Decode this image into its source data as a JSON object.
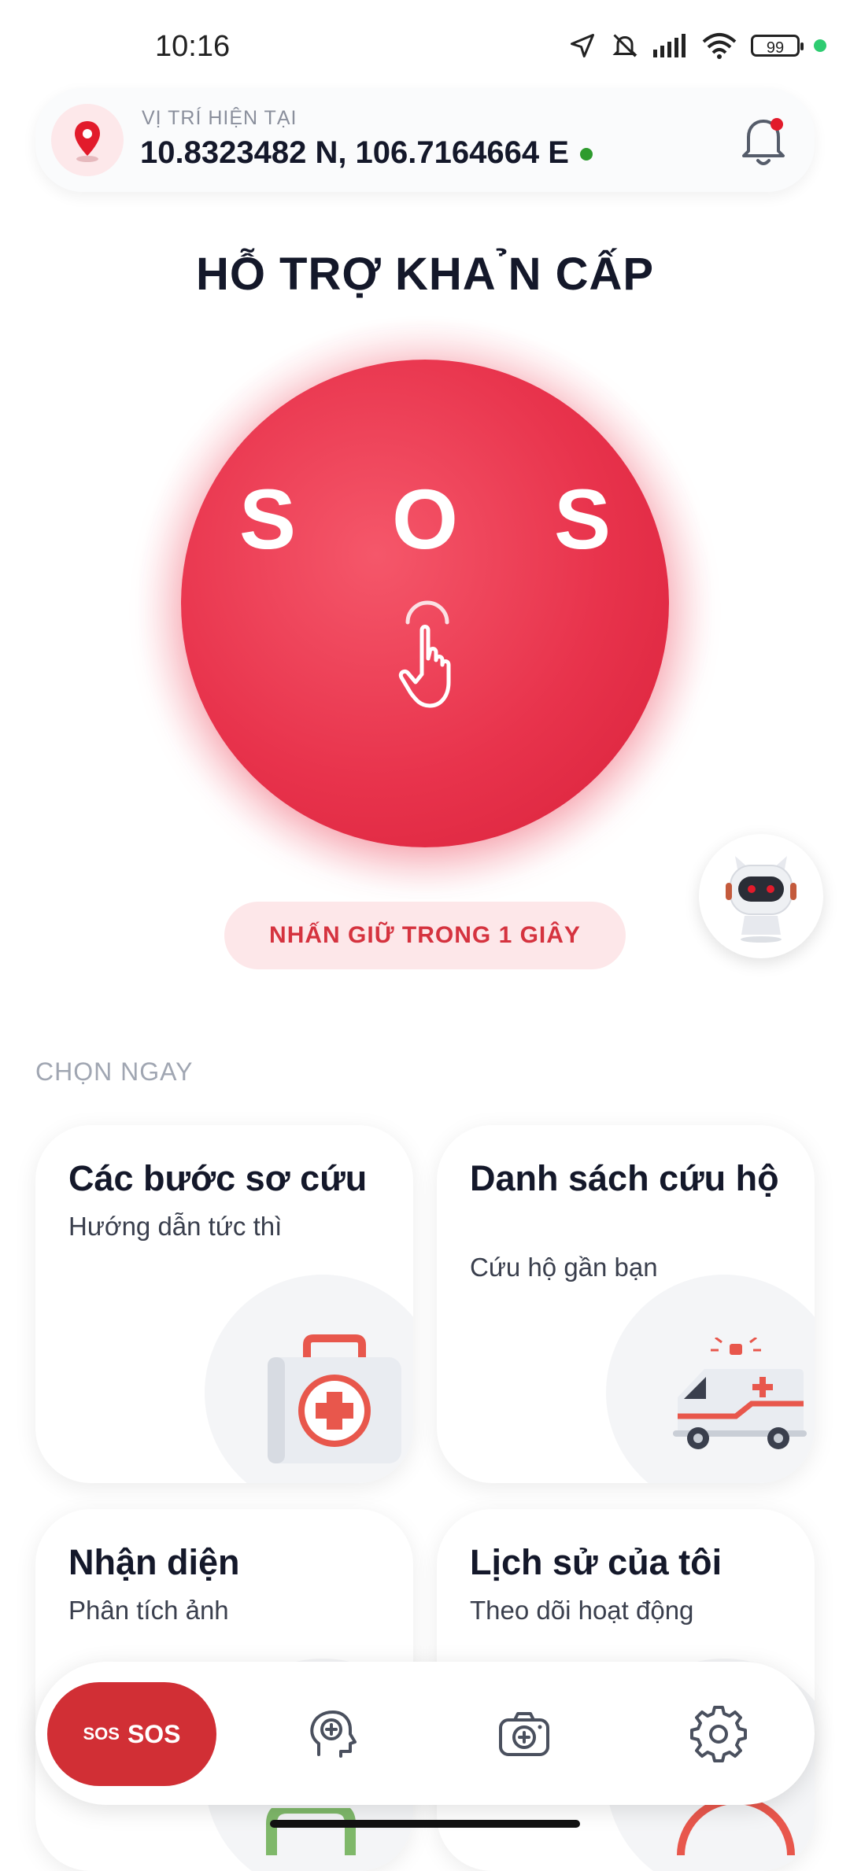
{
  "status_bar": {
    "time": "10:16",
    "battery": "99",
    "icons": [
      "location-arrow-icon",
      "bell-off-icon",
      "signal-icon",
      "wifi-icon",
      "battery-icon",
      "green-dot"
    ]
  },
  "location": {
    "label": "VỊ TRÍ HIỆN TẠI",
    "coords": "10.8323482 N, 106.7164664 E",
    "pin_icon": "location-pin-icon",
    "notification_icon": "bell-icon"
  },
  "page_title": "HỖ TRỢ KHA ̉N CẤP",
  "sos": {
    "label": "S O S",
    "hint": "NHẤN GIỮ TRONG 1 GIÂY"
  },
  "assistant": {
    "icon": "robot-icon"
  },
  "section_label": "CHỌN NGAY",
  "cards": [
    {
      "title": "Các bước sơ cứu",
      "subtitle": "Hướng dẫn tức thì",
      "icon": "first-aid-kit-icon"
    },
    {
      "title": "Danh sách cứu hộ",
      "subtitle": "Cứu hộ gần bạn",
      "icon": "ambulance-icon"
    },
    {
      "title": "Nhận diện",
      "subtitle": "Phân tích ảnh",
      "icon": "image-scan-icon"
    },
    {
      "title": "Lịch sử của tôi",
      "subtitle": "Theo dõi hoạt động",
      "icon": "history-icon"
    }
  ],
  "bottom_nav": {
    "sos_icon_text": "SOS",
    "sos_label": "SOS",
    "items": [
      "head-plus-icon",
      "camera-plus-icon",
      "gear-icon"
    ]
  },
  "colors": {
    "accent": "#e8334c",
    "nav_sos": "#d12f35",
    "hint_bg": "#fde7e9",
    "hint_text": "#d5333f"
  }
}
